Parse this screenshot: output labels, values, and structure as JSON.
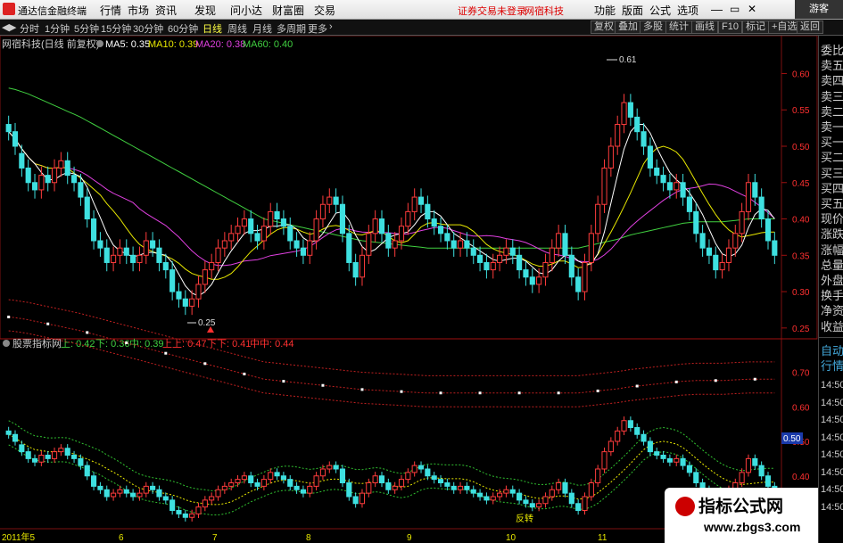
{
  "app": {
    "title": "通达信金融终端",
    "guest_label": "游客"
  },
  "menu": {
    "items": [
      "行情",
      "市场",
      "资讯",
      "发现",
      "问小达",
      "财富圈",
      "交易"
    ],
    "warning": "证券交易未登录",
    "stock_name": "网宿科技",
    "right_items": [
      "功能",
      "版面",
      "公式",
      "选项"
    ]
  },
  "toolbar": {
    "periods": [
      "分时",
      "1分钟",
      "5分钟",
      "15分钟",
      "30分钟",
      "60分钟",
      "日线",
      "周线",
      "月线",
      "多周期",
      "更多"
    ],
    "active": "日线",
    "right_buttons": [
      "复权",
      "叠加",
      "多股",
      "统计",
      "画线",
      "F10",
      "标记",
      "+自选",
      "返回"
    ]
  },
  "main_chart": {
    "header": {
      "title": "网宿科技(日线 前复权)",
      "ma": [
        {
          "label": "MA5: 0.35",
          "color": "#ffffff"
        },
        {
          "label": "MA10: 0.39",
          "color": "#e8e800"
        },
        {
          "label": "MA20: 0.38",
          "color": "#e040e0"
        },
        {
          "label": "MA60: 0.40",
          "color": "#40d040"
        }
      ]
    },
    "y_ticks": [
      "0.60",
      "0.55",
      "0.50",
      "0.45",
      "0.40",
      "0.35",
      "0.30",
      "0.25"
    ],
    "high_label": "0.61",
    "low_label": "0.25"
  },
  "indicator_chart": {
    "header": {
      "title": "股票指标网",
      "values": [
        {
          "label": "上: 0.42",
          "color": "#40d040"
        },
        {
          "label": "下: 0.36",
          "color": "#40d040"
        },
        {
          "label": "中: 0.39",
          "color": "#40d040"
        },
        {
          "label": "上上: 0.47",
          "color": "#ff3030"
        },
        {
          "label": "下下: 0.41",
          "color": "#ff3030"
        },
        {
          "label": "中中: 0.44",
          "color": "#ff3030"
        }
      ]
    },
    "y_ticks": [
      "0.70",
      "0.60",
      "0.50",
      "0.40"
    ],
    "current_value": "0.50",
    "annotations": [
      "反转"
    ]
  },
  "x_axis": {
    "labels": [
      "2011年5",
      "6",
      "7",
      "8",
      "9",
      "10",
      "11"
    ]
  },
  "side_panel": {
    "items": [
      "委比",
      "卖五",
      "卖四",
      "卖三",
      "卖二",
      "卖一",
      "买一",
      "买二",
      "买三",
      "买四",
      "买五",
      "现价",
      "涨跌",
      "涨幅",
      "总量",
      "外盘",
      "换手",
      "净资",
      "收益"
    ],
    "lower_items": [
      "自动",
      "行情"
    ],
    "times": [
      "14:50",
      "14:50",
      "14:50",
      "14:50",
      "14:50",
      "14:50",
      "14:50",
      "14:50"
    ]
  },
  "watermark": {
    "line1": "指标公式网",
    "line2": "www.zbgs3.com"
  },
  "chart_data": {
    "type": "candlestick",
    "price_range": [
      0.24,
      0.63
    ],
    "close": [
      0.52,
      0.5,
      0.47,
      0.45,
      0.44,
      0.46,
      0.45,
      0.47,
      0.48,
      0.46,
      0.45,
      0.43,
      0.4,
      0.37,
      0.36,
      0.34,
      0.35,
      0.36,
      0.35,
      0.34,
      0.35,
      0.37,
      0.36,
      0.34,
      0.33,
      0.3,
      0.29,
      0.28,
      0.29,
      0.31,
      0.33,
      0.34,
      0.36,
      0.37,
      0.38,
      0.39,
      0.4,
      0.38,
      0.37,
      0.39,
      0.41,
      0.4,
      0.39,
      0.37,
      0.36,
      0.35,
      0.37,
      0.4,
      0.42,
      0.43,
      0.42,
      0.38,
      0.34,
      0.32,
      0.35,
      0.38,
      0.4,
      0.38,
      0.36,
      0.37,
      0.39,
      0.41,
      0.43,
      0.42,
      0.4,
      0.39,
      0.38,
      0.37,
      0.36,
      0.37,
      0.36,
      0.35,
      0.34,
      0.33,
      0.34,
      0.35,
      0.36,
      0.35,
      0.33,
      0.32,
      0.31,
      0.32,
      0.34,
      0.36,
      0.38,
      0.35,
      0.32,
      0.3,
      0.34,
      0.38,
      0.42,
      0.47,
      0.5,
      0.53,
      0.56,
      0.54,
      0.52,
      0.5,
      0.47,
      0.46,
      0.45,
      0.44,
      0.45,
      0.43,
      0.41,
      0.38,
      0.36,
      0.35,
      0.33,
      0.34,
      0.36,
      0.38,
      0.41,
      0.45,
      0.43,
      0.4,
      0.37,
      0.35
    ],
    "open": [
      0.53,
      0.52,
      0.49,
      0.47,
      0.45,
      0.44,
      0.46,
      0.45,
      0.47,
      0.48,
      0.46,
      0.45,
      0.43,
      0.4,
      0.37,
      0.36,
      0.34,
      0.35,
      0.36,
      0.35,
      0.34,
      0.35,
      0.37,
      0.36,
      0.34,
      0.33,
      0.3,
      0.29,
      0.28,
      0.29,
      0.31,
      0.33,
      0.34,
      0.36,
      0.37,
      0.38,
      0.39,
      0.4,
      0.38,
      0.37,
      0.39,
      0.41,
      0.4,
      0.39,
      0.37,
      0.36,
      0.35,
      0.37,
      0.4,
      0.42,
      0.43,
      0.42,
      0.38,
      0.34,
      0.32,
      0.35,
      0.38,
      0.4,
      0.38,
      0.36,
      0.37,
      0.39,
      0.41,
      0.43,
      0.42,
      0.4,
      0.39,
      0.38,
      0.37,
      0.36,
      0.37,
      0.36,
      0.35,
      0.34,
      0.33,
      0.34,
      0.35,
      0.36,
      0.35,
      0.33,
      0.32,
      0.31,
      0.32,
      0.34,
      0.36,
      0.38,
      0.35,
      0.32,
      0.3,
      0.34,
      0.38,
      0.42,
      0.47,
      0.5,
      0.53,
      0.56,
      0.54,
      0.52,
      0.5,
      0.47,
      0.46,
      0.45,
      0.44,
      0.45,
      0.43,
      0.41,
      0.38,
      0.36,
      0.35,
      0.33,
      0.34,
      0.36,
      0.38,
      0.41,
      0.45,
      0.43,
      0.4,
      0.37
    ],
    "ma60": [
      0.58,
      0.578,
      0.575,
      0.572,
      0.568,
      0.564,
      0.56,
      0.556,
      0.552,
      0.548,
      0.544,
      0.54,
      0.535,
      0.53,
      0.525,
      0.52,
      0.515,
      0.51,
      0.505,
      0.5,
      0.495,
      0.49,
      0.485,
      0.48,
      0.475,
      0.47,
      0.465,
      0.46,
      0.455,
      0.45,
      0.445,
      0.44,
      0.435,
      0.43,
      0.425,
      0.42,
      0.415,
      0.41,
      0.405,
      0.4,
      0.398,
      0.396,
      0.394,
      0.392,
      0.39,
      0.388,
      0.386,
      0.384,
      0.382,
      0.38,
      0.378,
      0.376,
      0.374,
      0.372,
      0.37,
      0.369,
      0.368,
      0.367,
      0.366,
      0.365,
      0.364,
      0.363,
      0.362,
      0.361,
      0.36,
      0.36,
      0.36,
      0.36,
      0.36,
      0.36,
      0.36,
      0.36,
      0.36,
      0.36,
      0.36,
      0.36,
      0.36,
      0.36,
      0.36,
      0.36,
      0.36,
      0.36,
      0.36,
      0.36,
      0.36,
      0.36,
      0.36,
      0.36,
      0.362,
      0.364,
      0.366,
      0.368,
      0.37,
      0.372,
      0.375,
      0.378,
      0.38,
      0.382,
      0.384,
      0.386,
      0.388,
      0.39,
      0.392,
      0.394,
      0.395,
      0.396,
      0.396,
      0.396,
      0.396,
      0.396,
      0.397,
      0.398,
      0.399,
      0.4,
      0.4,
      0.4,
      0.4,
      0.4
    ]
  }
}
